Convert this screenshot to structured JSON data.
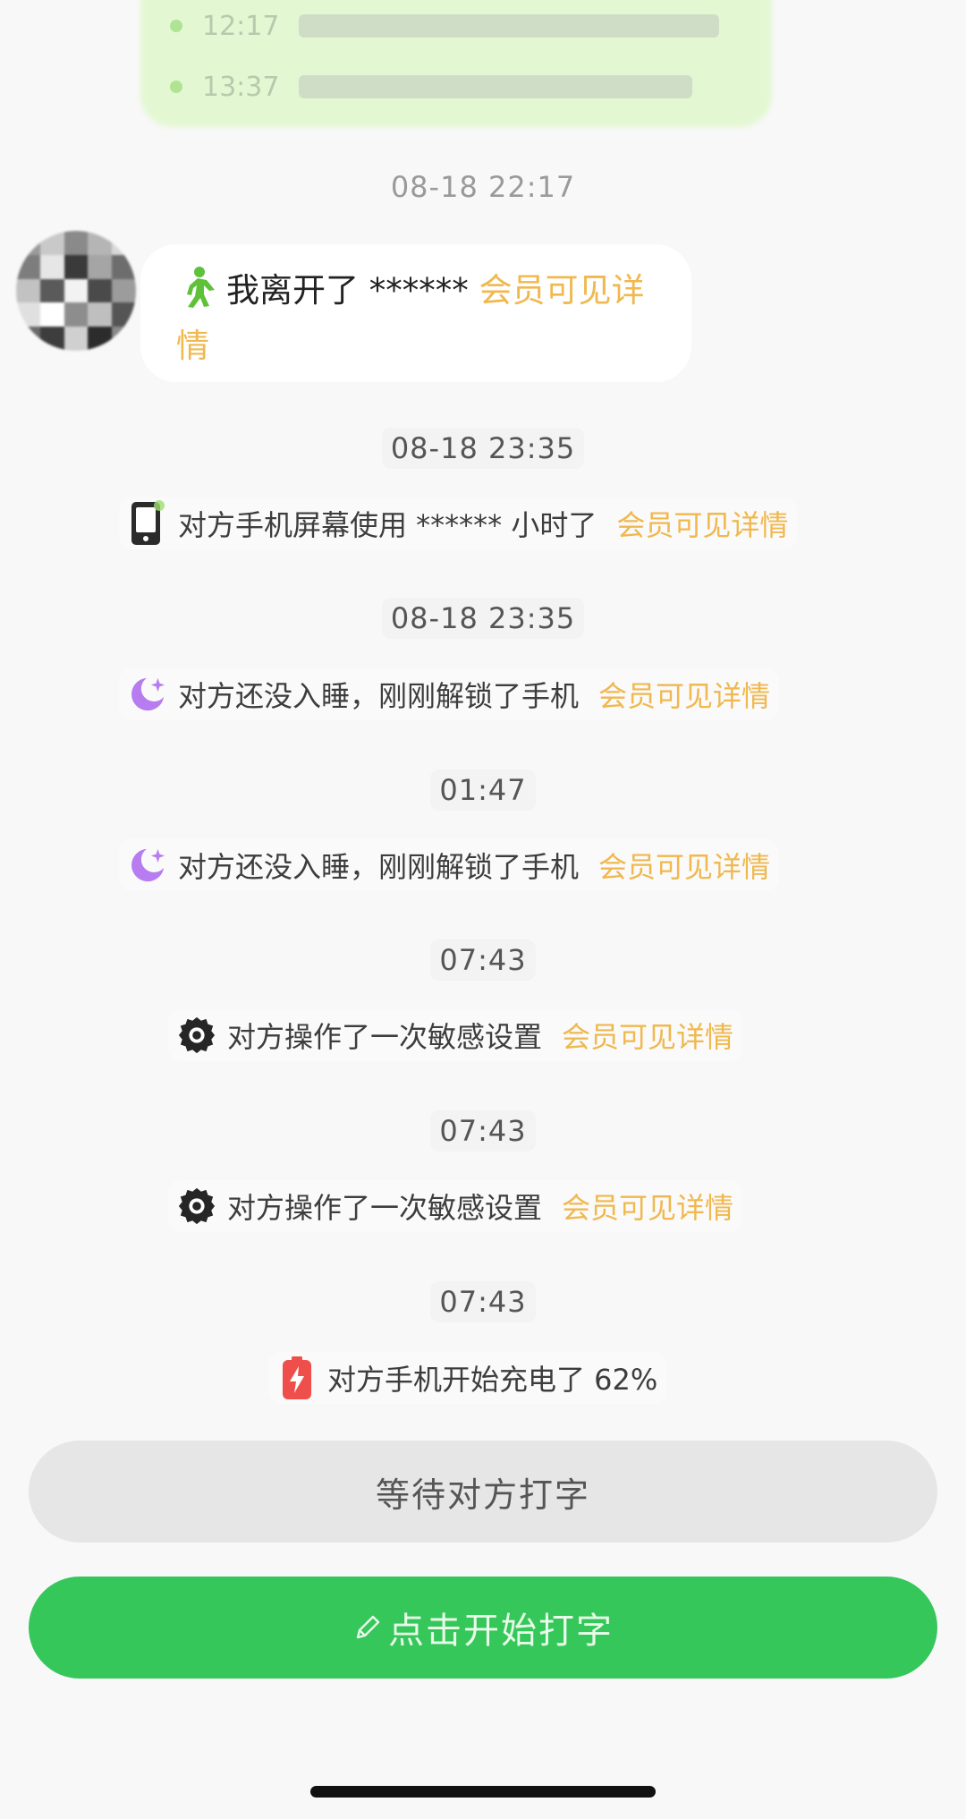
{
  "previous_bubble": {
    "lines": [
      "12:17",
      "13:37"
    ]
  },
  "first_timestamp": "08-18 22:17",
  "chat_message": {
    "text": "我离开了 ******",
    "link": "会员可见详情"
  },
  "events": [
    {
      "time": "08-18 23:35",
      "icon": "phone-screen-icon",
      "text": "对方手机屏幕使用 ****** 小时了",
      "link": "会员可见详情"
    },
    {
      "time": "08-18 23:35",
      "icon": "moon-icon",
      "text": "对方还没入睡，刚刚解锁了手机",
      "link": "会员可见详情"
    },
    {
      "time": "01:47",
      "icon": "moon-icon",
      "text": "对方还没入睡，刚刚解锁了手机",
      "link": "会员可见详情"
    },
    {
      "time": "07:43",
      "icon": "gear-icon",
      "text": "对方操作了一次敏感设置",
      "link": "会员可见详情"
    },
    {
      "time": "07:43",
      "icon": "gear-icon",
      "text": "对方操作了一次敏感设置",
      "link": "会员可见详情"
    },
    {
      "time": "07:43",
      "icon": "battery-charging-icon",
      "text": "对方手机开始充电了 62%",
      "link": ""
    }
  ],
  "buttons": {
    "wait_label": "等待对方打字",
    "type_label": "点击开始打字"
  },
  "colors": {
    "accent_gold": "#f0b84e",
    "green": "#35c75a",
    "purple": "#b67cf0"
  }
}
